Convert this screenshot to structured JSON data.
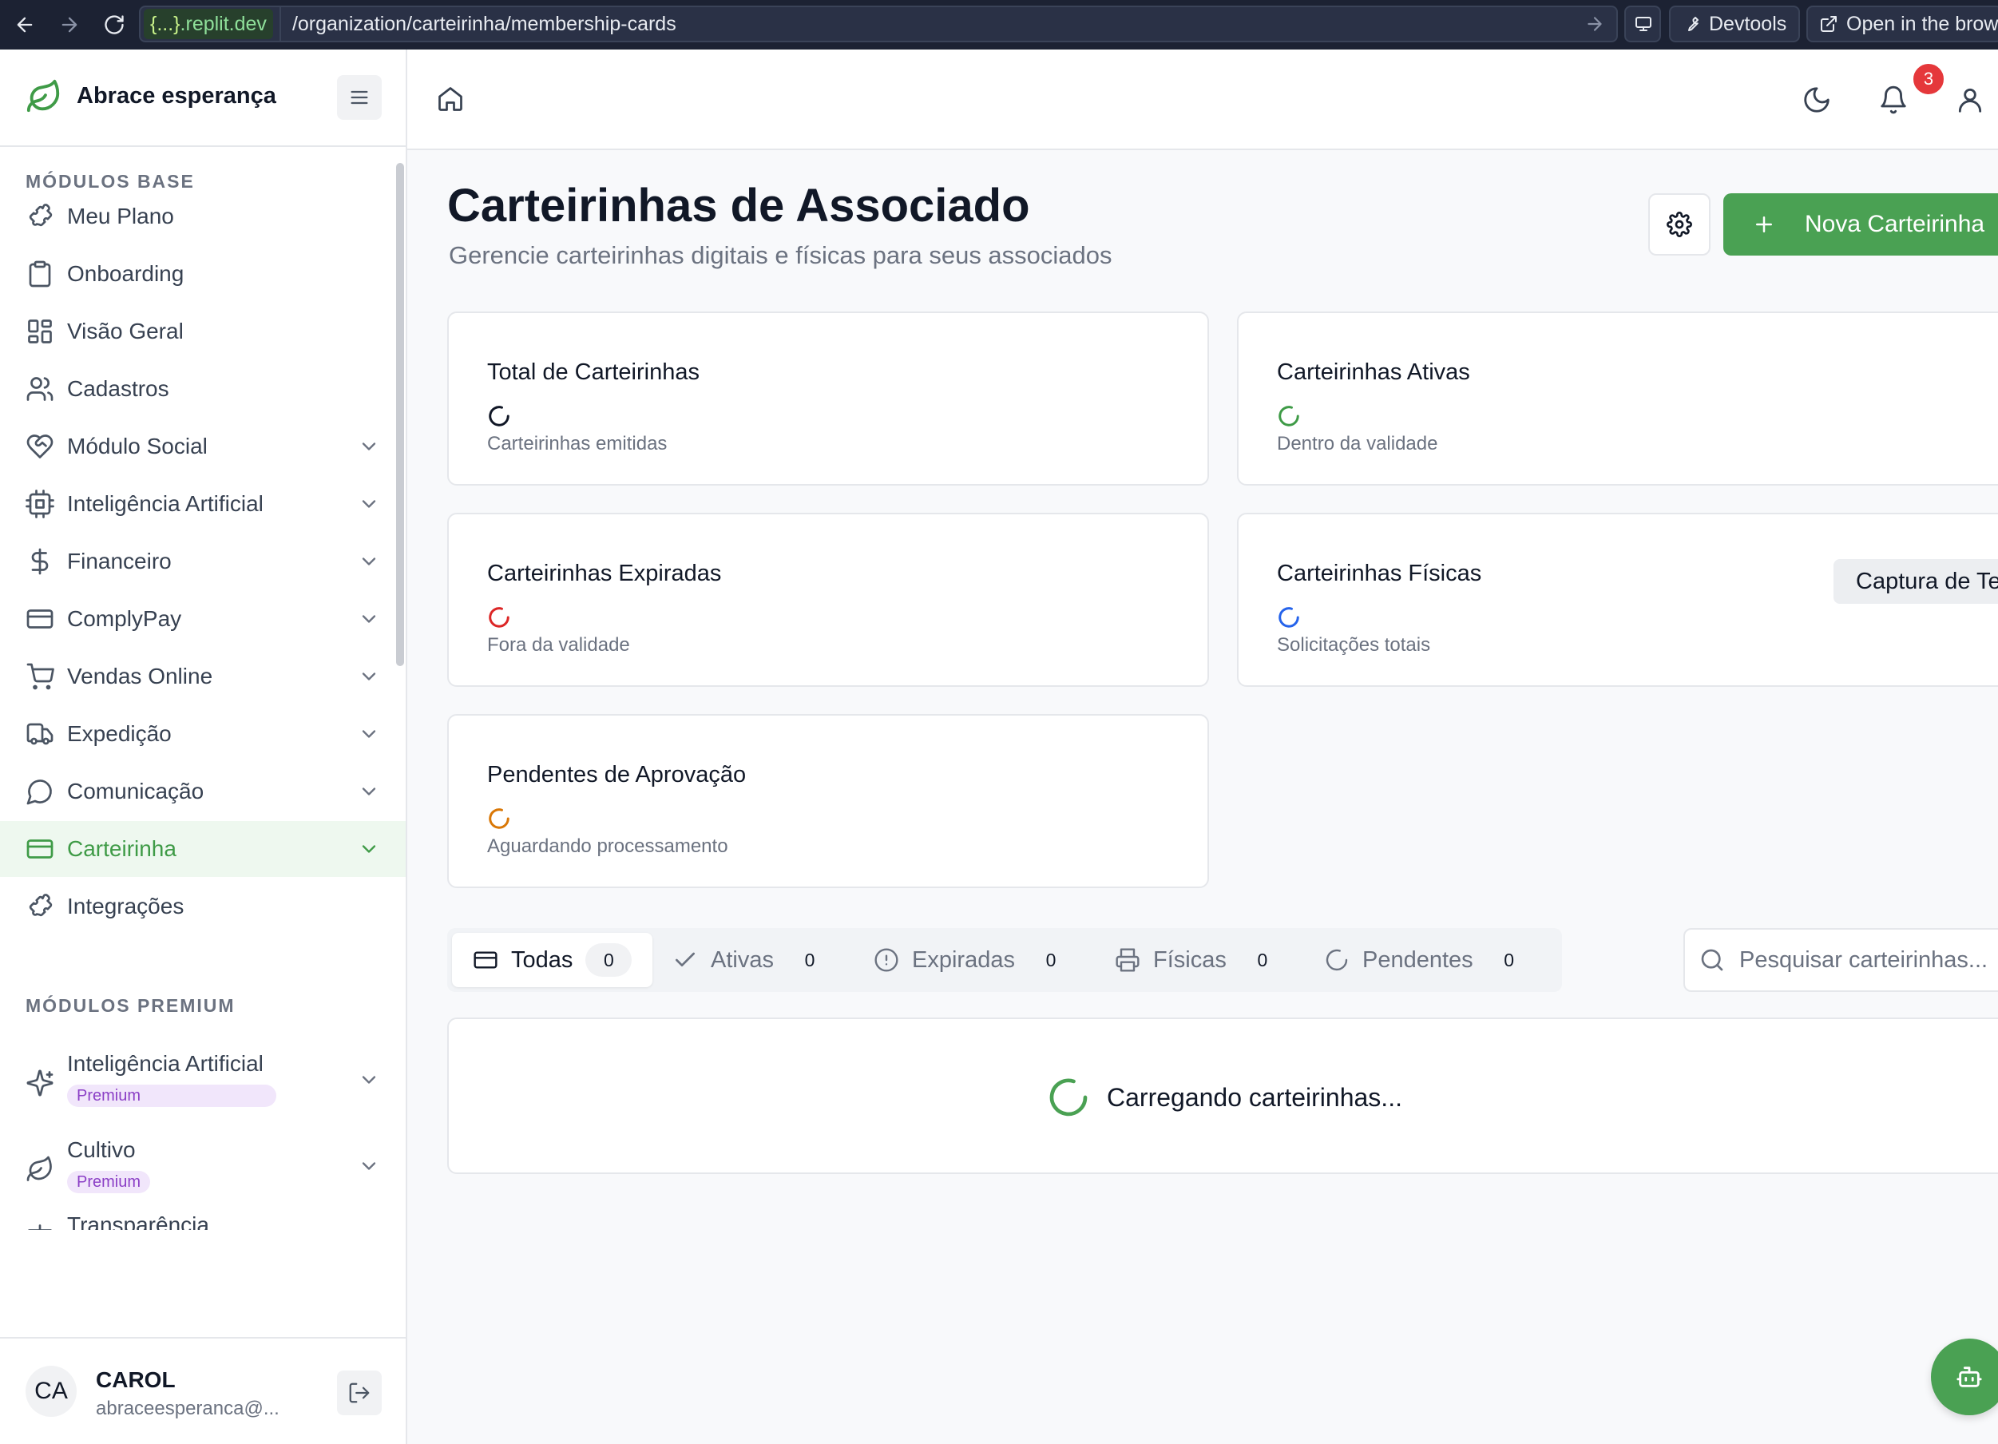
{
  "browser": {
    "url_host_brace": "{...}",
    "url_host": ".replit.dev",
    "url_path": "/organization/carteirinha/membership-cards",
    "devtools_label": "Devtools",
    "open_browser_label": "Open in the brows"
  },
  "sidebar": {
    "brand_name": "Abrace esperança",
    "base_section_label": "MÓDULOS BASE",
    "premium_section_label": "MÓDULOS PREMIUM",
    "items": [
      {
        "label": "Meu Plano",
        "icon": "puzzle-icon",
        "has_chevron": false
      },
      {
        "label": "Onboarding",
        "icon": "clipboard-icon",
        "has_chevron": false
      },
      {
        "label": "Visão Geral",
        "icon": "dashboard-icon",
        "has_chevron": false
      },
      {
        "label": "Cadastros",
        "icon": "users-icon",
        "has_chevron": false
      },
      {
        "label": "Módulo Social",
        "icon": "heart-handshake-icon",
        "has_chevron": true
      },
      {
        "label": "Inteligência Artificial",
        "icon": "cpu-icon",
        "has_chevron": true
      },
      {
        "label": "Financeiro",
        "icon": "dollar-icon",
        "has_chevron": true
      },
      {
        "label": "ComplyPay",
        "icon": "credit-card-icon",
        "has_chevron": true
      },
      {
        "label": "Vendas Online",
        "icon": "cart-icon",
        "has_chevron": true
      },
      {
        "label": "Expedição",
        "icon": "truck-icon",
        "has_chevron": true
      },
      {
        "label": "Comunicação",
        "icon": "message-icon",
        "has_chevron": true
      },
      {
        "label": "Carteirinha",
        "icon": "card-icon",
        "has_chevron": true,
        "active": true
      },
      {
        "label": "Integrações",
        "icon": "puzzle-icon",
        "has_chevron": false
      }
    ],
    "premium_items": [
      {
        "label": "Inteligência Artificial",
        "badge": "Premium",
        "icon": "sparkles-icon"
      },
      {
        "label": "Cultivo",
        "badge": "Premium",
        "icon": "leaf-icon"
      },
      {
        "label": "Transparência",
        "icon": "scale-icon"
      }
    ],
    "user": {
      "initials": "CA",
      "name": "CAROL",
      "email": "abraceesperanca@..."
    }
  },
  "header": {
    "notification_count": "3"
  },
  "main": {
    "title": "Carteirinhas de Associado",
    "subtitle": "Gerencie carteirinhas digitais e físicas para seus associados",
    "new_button_label": "Nova Carteirinha",
    "stats": [
      {
        "title": "Total de Carteirinhas",
        "desc": "Carteirinhas emitidas",
        "color": "#111827"
      },
      {
        "title": "Carteirinhas Ativas",
        "desc": "Dentro da validade",
        "color": "#3f9b47"
      },
      {
        "title": "Carteirinhas Expiradas",
        "desc": "Fora da validade",
        "color": "#dc2626"
      },
      {
        "title": "Carteirinhas Físicas",
        "desc": "Solicitações totais",
        "color": "#2563eb"
      },
      {
        "title": "Pendentes de Aprovação",
        "desc": "Aguardando processamento",
        "color": "#d97706"
      }
    ],
    "capture_tooltip": "Captura de Te",
    "tabs": [
      {
        "label": "Todas",
        "count": "0",
        "icon": "card-icon",
        "active": true
      },
      {
        "label": "Ativas",
        "count": "0",
        "icon": "check-icon"
      },
      {
        "label": "Expiradas",
        "count": "0",
        "icon": "alert-circle-icon"
      },
      {
        "label": "Físicas",
        "count": "0",
        "icon": "printer-icon"
      },
      {
        "label": "Pendentes",
        "count": "0",
        "icon": "loader-icon"
      }
    ],
    "search_placeholder": "Pesquisar carteirinhas...",
    "loading_text": "Carregando carteirinhas..."
  },
  "colors": {
    "accent": "#4aa153",
    "active_bg": "#eef8ef",
    "premium_bg": "#f1e6fb",
    "premium_text": "#8b3fc6",
    "browser_bar": "#1c2233"
  }
}
